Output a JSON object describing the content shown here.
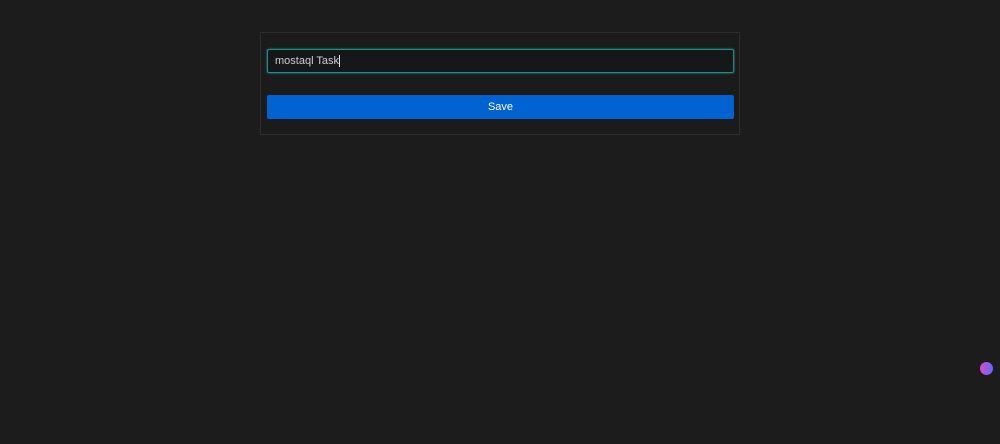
{
  "form": {
    "task_value": "mostaql Task",
    "save_label": "Save"
  },
  "colors": {
    "accent": "#0063d1",
    "focus": "#1e8f88"
  },
  "icons": {
    "corner": "extension-icon"
  }
}
